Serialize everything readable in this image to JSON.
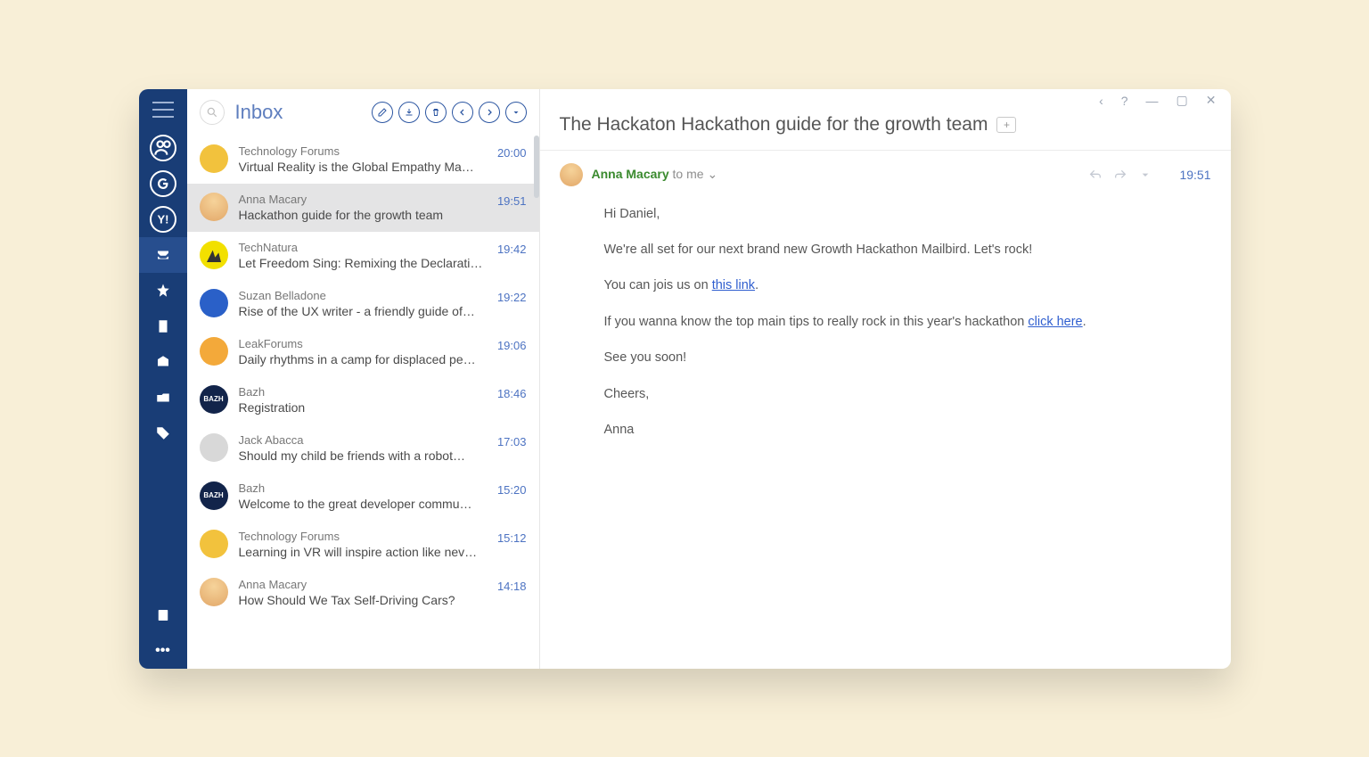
{
  "window_controls": {
    "back": "‹",
    "help": "?",
    "minimize": "—",
    "maximize": "▢",
    "close": "✕"
  },
  "folder_title": "Inbox",
  "toolbar": {
    "compose": "compose",
    "archive": "archive",
    "delete": "delete",
    "reply": "reply",
    "forward": "forward",
    "more": "more"
  },
  "emails": [
    {
      "sender": "Technology Forums",
      "subject": "Virtual Reality is the Global Empathy Ma…",
      "time": "20:00",
      "avatar": "yellow"
    },
    {
      "sender": "Anna Macary",
      "subject": "Hackathon guide for the growth team",
      "time": "19:51",
      "avatar": "face",
      "selected": true
    },
    {
      "sender": "TechNatura",
      "subject": "Let Freedom Sing: Remixing the Declarati…",
      "time": "19:42",
      "avatar": "green"
    },
    {
      "sender": "Suzan Belladone",
      "subject": "Rise of the UX writer - a friendly guide of…",
      "time": "19:22",
      "avatar": "blue"
    },
    {
      "sender": "LeakForums",
      "subject": "Daily rhythms in a camp for displaced pe…",
      "time": "19:06",
      "avatar": "orange"
    },
    {
      "sender": "Bazh",
      "subject": "Registration",
      "time": "18:46",
      "avatar": "navy"
    },
    {
      "sender": "Jack Abacca",
      "subject": "Should my child be friends with a robot…",
      "time": "17:03",
      "avatar": "grey"
    },
    {
      "sender": "Bazh",
      "subject": "Welcome to the great developer commu…",
      "time": "15:20",
      "avatar": "navy"
    },
    {
      "sender": "Technology Forums",
      "subject": "Learning in VR will inspire action like nev…",
      "time": "15:12",
      "avatar": "yellow"
    },
    {
      "sender": "Anna Macary",
      "subject": "How Should We Tax Self-Driving Cars?",
      "time": "14:18",
      "avatar": "face"
    }
  ],
  "message": {
    "title": "The Hackaton Hackathon guide for the growth team",
    "from_name": "Anna Macary",
    "to_label": "to me",
    "time": "19:51",
    "body": {
      "greet": "Hi Daniel,",
      "p1": "We're all set for our next brand new Growth Hackathon Mailbird. Let's rock!",
      "p2_pre": "You can jois us on ",
      "p2_link": "this link",
      "p2_post": ".",
      "p3_pre": "If you wanna know the top main tips to really rock in this year's hackathon ",
      "p3_link": "click here",
      "p3_post": ".",
      "p4": "See you soon!",
      "p5": "Cheers,",
      "p6": "Anna"
    }
  },
  "accounts": [
    "unified",
    "google",
    "yahoo"
  ],
  "sidenav": [
    "inbox",
    "starred",
    "notes",
    "attachments",
    "files",
    "tags"
  ]
}
